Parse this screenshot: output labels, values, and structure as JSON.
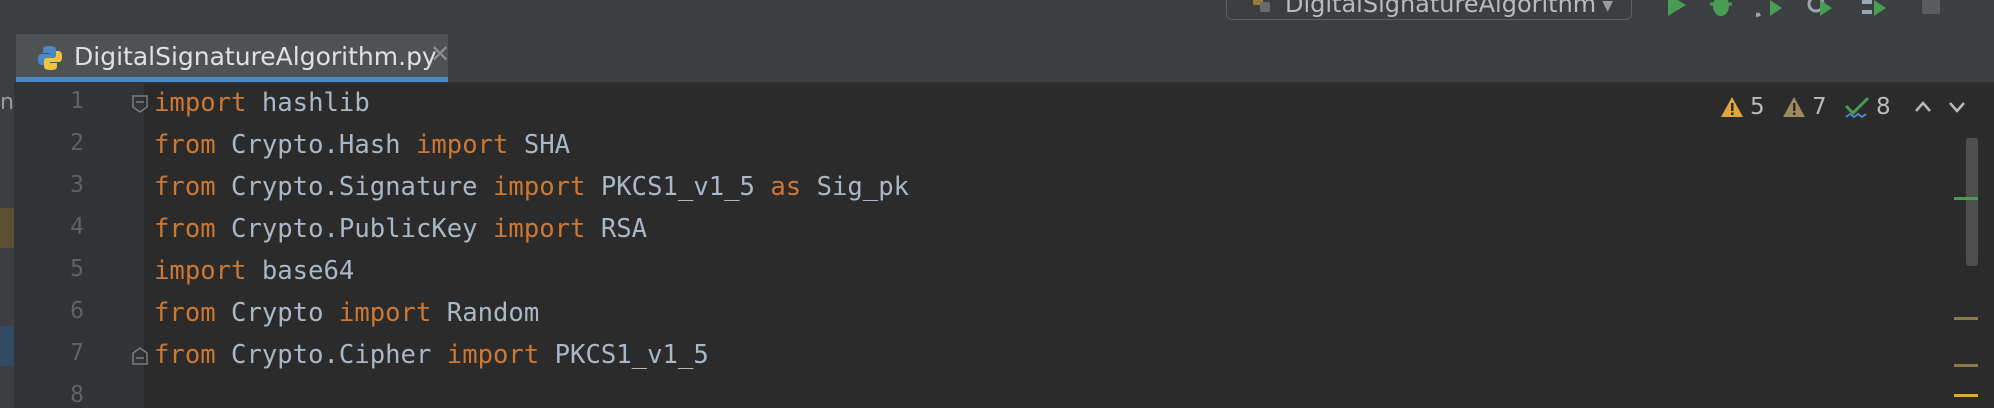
{
  "toolbar": {
    "run_config": "DigitalSignatureAlgorithm",
    "colors": {
      "run": "#499c54",
      "debug": "#499c54"
    }
  },
  "editor": {
    "tab": {
      "filename": "DigitalSignatureAlgorithm.py"
    },
    "left_strip_label": "nF",
    "line_numbers": [
      "1",
      "2",
      "3",
      "4",
      "5",
      "6",
      "7",
      "8"
    ],
    "lines": [
      [
        [
          "kw",
          "import"
        ],
        [
          "t",
          " hashlib"
        ]
      ],
      [
        [
          "kw",
          "from"
        ],
        [
          "t",
          " Crypto.Hash "
        ],
        [
          "kw",
          "import"
        ],
        [
          "t",
          " SHA"
        ]
      ],
      [
        [
          "kw",
          "from"
        ],
        [
          "t",
          " Crypto.Signature "
        ],
        [
          "kw",
          "import"
        ],
        [
          "t",
          " PKCS1_v1_5 "
        ],
        [
          "kw",
          "as"
        ],
        [
          "t",
          " Sig_pk"
        ]
      ],
      [
        [
          "kw",
          "from"
        ],
        [
          "t",
          " Crypto.PublicKey "
        ],
        [
          "kw",
          "import"
        ],
        [
          "t",
          " RSA"
        ]
      ],
      [
        [
          "kw",
          "import"
        ],
        [
          "t",
          " base64"
        ]
      ],
      [
        [
          "kw",
          "from"
        ],
        [
          "t",
          " Crypto "
        ],
        [
          "kw",
          "import"
        ],
        [
          "t",
          " Random"
        ]
      ],
      [
        [
          "kw",
          "from"
        ],
        [
          "t",
          " Crypto.Cipher "
        ],
        [
          "kw",
          "import"
        ],
        [
          "t",
          " PKCS1_v1_5"
        ]
      ],
      []
    ],
    "inspections": {
      "warnings": "5",
      "weak_warnings": "7",
      "typos": "8"
    },
    "colors": {
      "keyword": "#cc7832",
      "text": "#a9b7c6",
      "warning": "#e0a63a",
      "typo": "#499c54"
    }
  }
}
